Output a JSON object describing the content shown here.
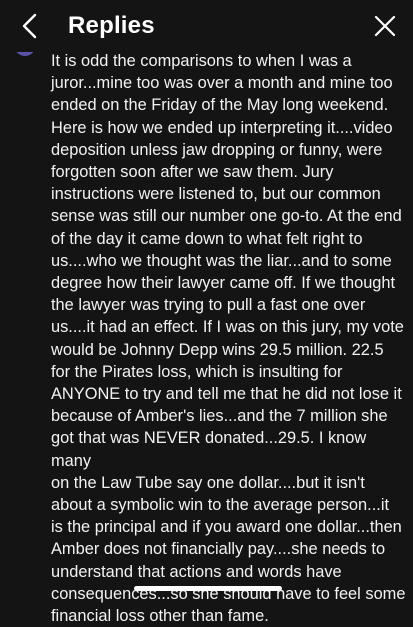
{
  "header": {
    "title": "Replies"
  },
  "icons": {
    "back": "chevron-left-icon",
    "close": "close-x-icon"
  },
  "reply": {
    "text": "It is odd the comparisons to when I was a\njuror...mine too was over a month and mine too\nended on the Friday of the May long weekend.\nHere is how we ended up interpreting it....video\ndeposition unless jaw dropping or funny, were\nforgotten soon after we saw them. Jury\ninstructions were listened to, but our common\nsense was still our number one go-to. At the end\nof the day it came down to what felt right to\nus....who we thought was the liar...and to some\ndegree how their lawyer came off. If we thought\nthe lawyer was trying to pull a fast one over\nus....it had an effect. If I was on this jury, my vote\nwould be Johnny Depp wins 29.5 million. 22.5\nfor the Pirates loss, which is insulting for\nANYONE to try and tell me that he did not lose it\nbecause of Amber's lies...and the 7 million she\ngot that was NEVER donated...29.5. I know many\non the Law Tube say one dollar....but it isn't\nabout a symbolic win to the average person...it\nis the principal and if you award one dollar...then\nAmber does not financially pay....she needs to\nunderstand that actions and words have\nconsequences...so she should have to feel some\nfinancial loss other than fame."
  },
  "colors": {
    "background": "#141414",
    "text": "#f2f2f2",
    "avatar": "#5b53a8"
  }
}
